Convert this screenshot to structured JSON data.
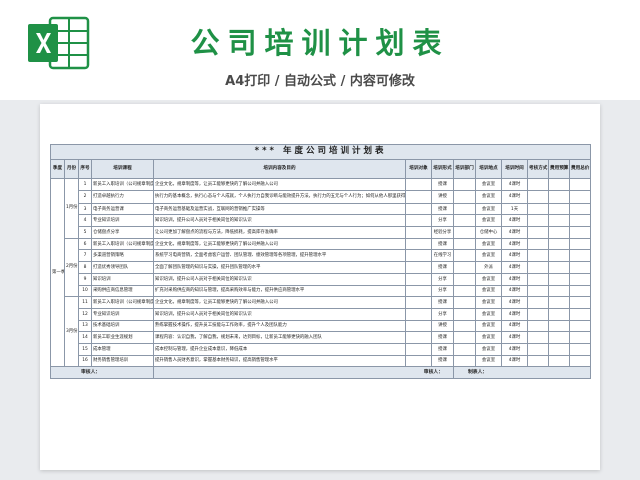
{
  "banner": {
    "title": "公司培训计划表",
    "subtitle": "A4打印 / 自动公式 / 内容可修改",
    "brand_color": "#1f9146"
  },
  "table": {
    "title": "*** 年度公司培训计划表",
    "headers": [
      "季度",
      "月份",
      "序号",
      "培训课程",
      "培训内容及目的",
      "培训对象",
      "培训形式",
      "培训部门",
      "培训地点",
      "培训时间",
      "考核方式",
      "费用预算",
      "费用总价"
    ],
    "rows": [
      {
        "quarter": "第一季度",
        "month": "1月份",
        "no": "1",
        "course": "新员工入职培训（公司规章制度介绍）",
        "content": "企业文化，规章制度等，让员工能够更快的了解公司并融入公司",
        "target": "",
        "form": "授课",
        "dept": "",
        "place": "会议室",
        "time": "4课时",
        "exam": "",
        "budget": "",
        "total": ""
      },
      {
        "quarter": "",
        "month": "",
        "no": "2",
        "course": "打造卓越执行力",
        "content": "执行力的基本概念，执行心态与个人成就，个人执行力自我诊断与能效提升方法，执行力的五元与个人行为；如何从他人那里获得支持，在工作中发挥目标，调整心态，管理个人职业规划；工作角色，情形之间；提高执行力与个人关系和规则",
        "target": "",
        "form": "讲授",
        "dept": "",
        "place": "会议室",
        "time": "4课时",
        "exam": "",
        "budget": "",
        "total": ""
      },
      {
        "quarter": "",
        "month": "",
        "no": "3",
        "course": "电子商务运营课",
        "content": "电子商务运营基础及运营实战，互联网的营销推广实操等",
        "target": "",
        "form": "授课",
        "dept": "",
        "place": "会议室",
        "time": "1天",
        "exam": "",
        "budget": "",
        "total": ""
      },
      {
        "quarter": "",
        "month": "",
        "no": "4",
        "course": "专业知识培训",
        "content": "知识培训，提升公司人员对于相关岗位的知识认识",
        "target": "",
        "form": "分享",
        "dept": "",
        "place": "会议室",
        "time": "4课时",
        "exam": "",
        "budget": "",
        "total": ""
      },
      {
        "quarter": "",
        "month": "",
        "no": "5",
        "course": "仓储盘点分享",
        "content": "让公司更加了解盘点的流程与方法，降低损耗，提高库存准确率",
        "target": "",
        "form": "经验分享",
        "dept": "",
        "place": "仓储中心",
        "time": "4课时",
        "exam": "",
        "budget": "",
        "total": ""
      },
      {
        "quarter": "",
        "month": "2月份",
        "no": "6",
        "course": "新员工入职培训（公司规章制度介绍）",
        "content": "企业文化，规章制度等，让员工能够更快的了解公司并融入公司",
        "target": "",
        "form": "授课",
        "dept": "",
        "place": "会议室",
        "time": "4课时",
        "exam": "",
        "budget": "",
        "total": ""
      },
      {
        "quarter": "",
        "month": "",
        "no": "7",
        "course": "多渠道营销策略",
        "content": "系统学习电商营销，全面考虑客户运营、团队管理、绩效管理等各项管理，提升管理水平",
        "target": "",
        "form": "在线学习",
        "dept": "",
        "place": "会议室",
        "time": "4课时",
        "exam": "",
        "budget": "",
        "total": ""
      },
      {
        "quarter": "",
        "month": "",
        "no": "8",
        "course": "打造优秀领导团队",
        "content": "全面了解团队管理的知识与实操，提升团队管理的水平",
        "target": "",
        "form": "授课",
        "dept": "",
        "place": "外派",
        "time": "4课时",
        "exam": "",
        "budget": "",
        "total": ""
      },
      {
        "quarter": "",
        "month": "",
        "no": "9",
        "course": "知识培训",
        "content": "知识培训，提升公司人员对于相关岗位的知识认识",
        "target": "",
        "form": "分享",
        "dept": "",
        "place": "会议室",
        "time": "4课时",
        "exam": "",
        "budget": "",
        "total": ""
      },
      {
        "quarter": "",
        "month": "",
        "no": "10",
        "course": "采购供应商信息管理",
        "content": "扩充对采购供应商的知识与管理，提高采购效率与能力，提升供应商管理水平",
        "target": "",
        "form": "分享",
        "dept": "",
        "place": "会议室",
        "time": "4课时",
        "exam": "",
        "budget": "",
        "total": ""
      },
      {
        "quarter": "",
        "month": "3月份",
        "no": "11",
        "course": "新员工入职培训（公司规章制度介绍）",
        "content": "企业文化，规章制度等，让员工能够更快的了解公司并融入公司",
        "target": "",
        "form": "授课",
        "dept": "",
        "place": "会议室",
        "time": "4课时",
        "exam": "",
        "budget": "",
        "total": ""
      },
      {
        "quarter": "",
        "month": "",
        "no": "12",
        "course": "专业知识培训",
        "content": "知识培训，提升公司人员对于相关岗位的知识认识",
        "target": "",
        "form": "分享",
        "dept": "",
        "place": "会议室",
        "time": "4课时",
        "exam": "",
        "budget": "",
        "total": ""
      },
      {
        "quarter": "",
        "month": "",
        "no": "13",
        "course": "技术基础培训",
        "content": "熟练掌握技术操作，提升员工技能与工作效率，提升个人及团队能力",
        "target": "",
        "form": "讲授",
        "dept": "",
        "place": "会议室",
        "time": "4课时",
        "exam": "",
        "budget": "",
        "total": ""
      },
      {
        "quarter": "",
        "month": "",
        "no": "14",
        "course": "新员工职业生涯规划",
        "content": "课程内容：认识自我，了解自我，规划未来，达到目标，让新员工能够更快的融入团队",
        "target": "",
        "form": "授课",
        "dept": "",
        "place": "会议室",
        "time": "4课时",
        "exam": "",
        "budget": "",
        "total": ""
      },
      {
        "quarter": "",
        "month": "",
        "no": "15",
        "course": "成本管理",
        "content": "成本控制与管理，提升企业成本意识，降低成本",
        "target": "",
        "form": "授课",
        "dept": "",
        "place": "会议室",
        "time": "4课时",
        "exam": "",
        "budget": "",
        "total": ""
      },
      {
        "quarter": "",
        "month": "",
        "no": "16",
        "course": "财务销售管理培训",
        "content": "提升销售人员财务意识，掌握基本财务知识，提高销售管理水平",
        "target": "",
        "form": "授课",
        "dept": "",
        "place": "会议室",
        "time": "4课时",
        "exam": "",
        "budget": "",
        "total": ""
      }
    ],
    "footer": {
      "reviewer1": "审核人：",
      "reviewer2": "审核人：",
      "maker": "制表人："
    }
  }
}
